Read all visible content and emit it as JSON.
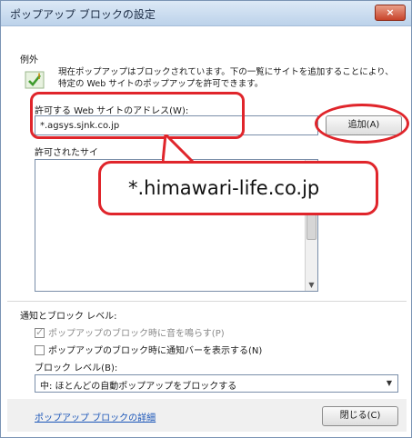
{
  "window": {
    "title": "ポップアップ ブロックの設定",
    "close_glyph": "×"
  },
  "exceptions": {
    "group_label": "例外",
    "info_text": "現在ポップアップはブロックされています。下の一覧にサイトを追加することにより、特定の Web サイトのポップアップを許可できます。",
    "address_label": "許可する Web サイトのアドレス(W):",
    "address_value": "*.agsys.sjnk.co.jp",
    "add_button": "追加(A)",
    "allowed_sites_label": "許可されたサイ"
  },
  "notification": {
    "group_label": "通知とブロック レベル:",
    "play_sound": "ポップアップのブロック時に音を鳴らす(P)",
    "show_bar": "ポップアップのブロック時に通知バーを表示する(N)",
    "block_level_label": "ブロック レベル(B):",
    "block_level_value": "中: ほとんどの自動ポップアップをブロックする"
  },
  "footer": {
    "help_link": "ポップアップ ブロックの詳細",
    "close_button": "閉じる(C)"
  },
  "annotation": {
    "callout_text": "*.himawari-life.co.jp",
    "color": "#e0252b"
  },
  "icons": {
    "info": "shield-check-icon",
    "dropdown": "chevron-down-icon",
    "scroll_down": "arrow-down-icon",
    "scroll_up": "arrow-up-icon"
  }
}
